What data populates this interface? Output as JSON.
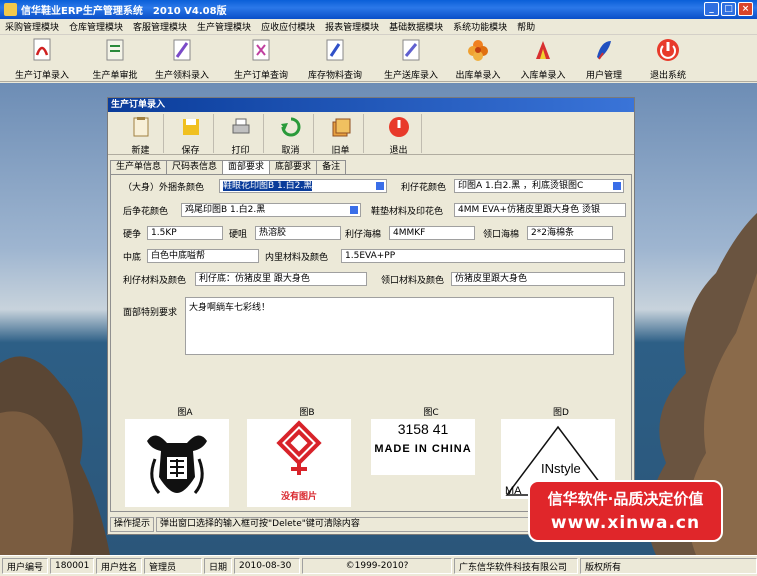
{
  "window": {
    "title": "信华鞋业ERP生产管理系统　2010 V4.08版"
  },
  "menu": [
    "采购管理模块",
    "仓库管理模块",
    "客服管理模块",
    "生产管理模块",
    "应收应付模块",
    "报表管理模块",
    "基础数据模块",
    "系统功能模块",
    "帮助"
  ],
  "toolbar": [
    {
      "label": "生产订单录入",
      "icon": "pdf-doc-icon"
    },
    {
      "label": "生产单审批",
      "icon": "approve-doc-icon"
    },
    {
      "label": "生产领料录入",
      "icon": "pick-material-icon"
    },
    {
      "label": "生产订单查询",
      "icon": "query-doc-icon"
    },
    {
      "label": "库存物料查询",
      "icon": "stock-query-icon"
    },
    {
      "label": "生产送库录入",
      "icon": "delivery-doc-icon"
    },
    {
      "label": "出库单录入",
      "icon": "outbound-flower-icon"
    },
    {
      "label": "入库单录入",
      "icon": "inbound-doc-icon"
    },
    {
      "label": "用户管理",
      "icon": "user-pen-icon"
    },
    {
      "label": "退出系统",
      "icon": "exit-power-icon"
    }
  ],
  "dialog": {
    "title": "生产订单录入",
    "tools": [
      "新建",
      "保存",
      "打印",
      "取消",
      "旧单",
      "退出"
    ],
    "tabs": [
      "生产单信息",
      "尺码表信息",
      "面部要求",
      "底部要求",
      "备注"
    ],
    "active_tab": "面部要求",
    "fields": {
      "waibang_label": "（大身）外捆条颜色",
      "waibang_value": "鞋眼花印图B 1.白2.黑",
      "lizai_color_label": "利仔花颜色",
      "lizai_color_value": "印图A  1.白2.黑 ，利底烫银图C",
      "houbang_label": "后争花颜色",
      "houbang_value": "鸡尾印图B 1.白2.黑",
      "xiedian_label": "鞋垫材料及印花色",
      "xiedian_value": "4MM EVA+仿猪皮里跟大身色 烫银",
      "yingzheng_label": "硬争",
      "yingzheng_value": "1.5KP",
      "yingchang_label": "硬咀",
      "yingchang_value": "热溶胶",
      "lizai_foam_label": "利仔海棉",
      "lizai_foam_value": "4MMKF",
      "collar_foam_label": "领口海棉",
      "collar_foam_value": "2*2海棉条",
      "zhongdi_label": "中底",
      "zhongdi_value": "白色中底嗌帮",
      "inner_label": "内里材料及颜色",
      "inner_value": "1.5EVA+PP",
      "lizai_mat_label": "利仔材料及颜色",
      "lizai_mat_value": "利仔底：仿猪皮里 跟大身色",
      "collar_mat_label": "领口材料及颜色",
      "collar_mat_value": "仿猪皮里跟大身色",
      "special_label": "面部特别要求",
      "special_value": "大身啊绱车七彩线！"
    },
    "images": [
      {
        "label": "图A"
      },
      {
        "label": "图B",
        "caption": "没有图片"
      },
      {
        "label": "图C",
        "line1": "3158  41",
        "line2": "MADE IN CHINA"
      },
      {
        "label": "图D",
        "text1": "INstyle",
        "text2": "MA"
      }
    ],
    "hint_label": "操作提示",
    "hint_text": "弹出窗口选择的输入框可按\"Delete\"键可清除内容"
  },
  "watermark": {
    "line1": "信华软件·品质决定价值",
    "line2": "www.xinwa.cn"
  },
  "status": {
    "user_id_label": "用户编号",
    "user_id": "180001",
    "user_name_label": "用户姓名",
    "user_name": "管理员",
    "date_label": "日期",
    "date": "2010-08-30",
    "copyright": "©1999-2010?",
    "company": "广东信华软件科技有限公司",
    "rights": "版权所有"
  }
}
